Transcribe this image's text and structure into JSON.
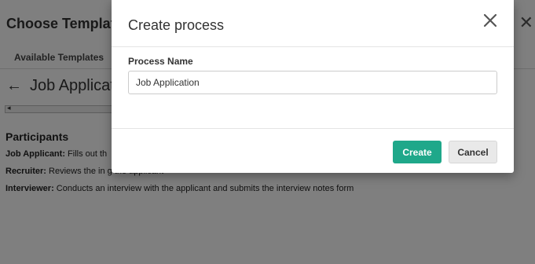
{
  "background": {
    "title": "Choose Templat",
    "tab": "Available Templates",
    "back_title": "Job Applicat",
    "participants_heading": "Participants",
    "lines": [
      {
        "role": "Job Applicant:",
        "text": " Fills out th"
      },
      {
        "role": "Recruiter:",
        "text": " Reviews the in                                                                                           g the applicant"
      },
      {
        "role": "Interviewer:",
        "text": " Conducts an interview with the applicant and submits the interview notes form"
      }
    ]
  },
  "modal": {
    "title": "Create process",
    "field_label": "Process Name",
    "field_value": "Job Application",
    "create_label": "Create",
    "cancel_label": "Cancel"
  }
}
